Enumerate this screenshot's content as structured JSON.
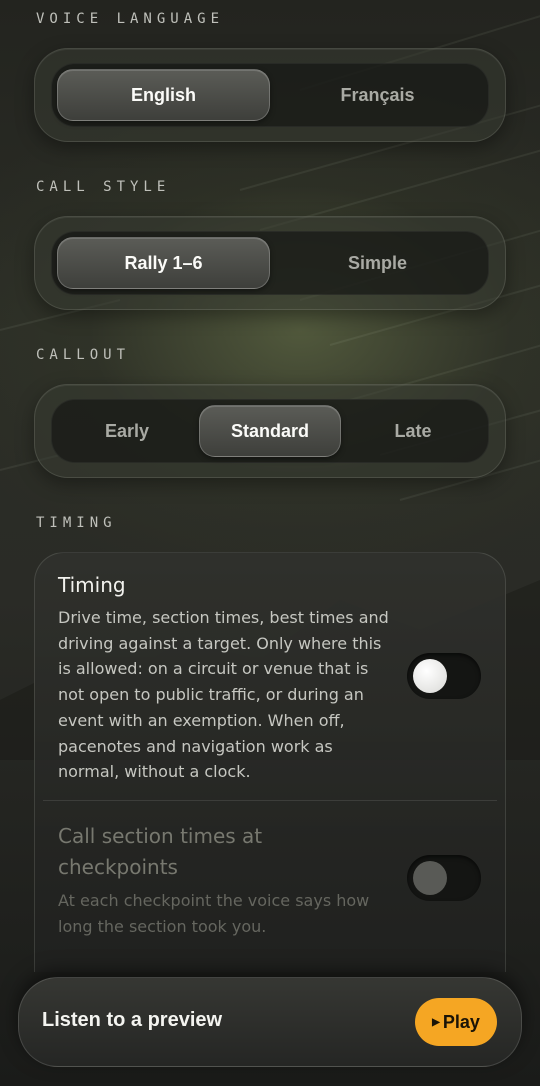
{
  "voice_language": {
    "label": "VOICE LANGUAGE",
    "options": [
      "English",
      "Français"
    ],
    "selected": "English"
  },
  "call_style": {
    "label": "CALL STYLE",
    "options": [
      "Rally 1–6",
      "Simple"
    ],
    "selected": "Rally 1–6"
  },
  "callout": {
    "label": "CALLOUT",
    "options": [
      "Early",
      "Standard",
      "Late"
    ],
    "selected": "Standard"
  },
  "timing": {
    "label": "TIMING",
    "rows": [
      {
        "title": "Timing",
        "description": "Drive time, section times, best times and driving against a target. Only where this is allowed: on a circuit or venue that is not open to public traffic, or during an event with an exemption. When off, pacenotes and navigation work as normal, without a clock.",
        "enabled": false
      },
      {
        "title": "Call section times at checkpoints",
        "description": "At each checkpoint the voice says how long the section took you.",
        "enabled": false
      }
    ]
  },
  "preview": {
    "label": "Listen to a preview",
    "play_icon": "play-triangle-icon",
    "play_label": "Play",
    "accent": "#f5a623"
  }
}
